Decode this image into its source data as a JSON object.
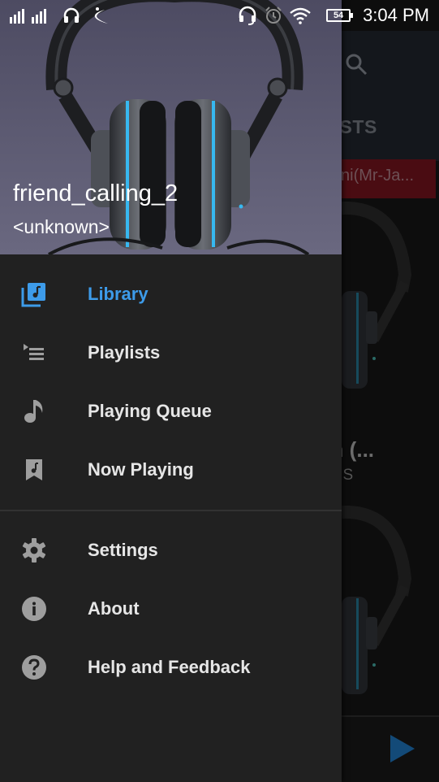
{
  "status_bar": {
    "time": "3:04 PM",
    "battery_level": "54",
    "left_icons": [
      "signal-icon",
      "headphones-icon",
      "app-notification-icon"
    ],
    "right_icons": [
      "headset-icon",
      "alarm-icon",
      "wifi-icon",
      "battery-icon"
    ]
  },
  "drawer": {
    "header": {
      "title": "friend_calling_2",
      "subtitle": "<unknown>"
    },
    "primary_items": [
      {
        "label": "Library",
        "icon": "library-music-icon",
        "active": true
      },
      {
        "label": "Playlists",
        "icon": "playlist-play-icon",
        "active": false
      },
      {
        "label": "Playing Queue",
        "icon": "music-note-icon",
        "active": false
      },
      {
        "label": "Now Playing",
        "icon": "now-playing-bookmark-icon",
        "active": false
      }
    ],
    "secondary_items": [
      {
        "label": "Settings",
        "icon": "gear-icon"
      },
      {
        "label": "About",
        "icon": "info-icon"
      },
      {
        "label": "Help and Feedback",
        "icon": "help-icon"
      }
    ]
  },
  "background_app": {
    "tab_partial": "RTISTS",
    "now_playing_banner": "ni(Mr-Ja...",
    "song_title_partial": "man (...",
    "song_artist_partial": "man. S"
  },
  "colors": {
    "accent": "#3d9be9",
    "drawer_bg": "#212121",
    "header_bg": "#5a5870",
    "icon_gray": "#9e9e9e",
    "play_button": "#134a78"
  }
}
